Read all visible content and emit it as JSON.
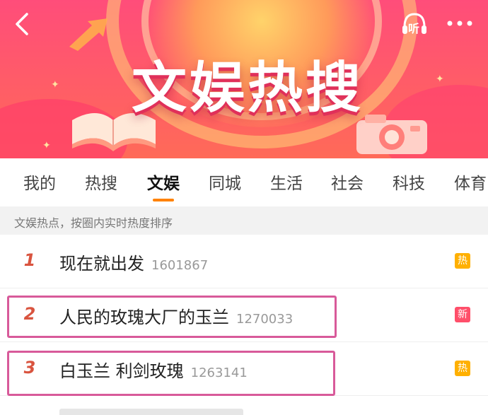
{
  "banner": {
    "title": "文娱热搜",
    "listen_label": "听",
    "colors": {
      "bg_top": "#ff4d7a",
      "bg_bottom": "#ff6a58",
      "accent": "#ffd36a"
    }
  },
  "tabs": [
    {
      "label": "我的",
      "active": false
    },
    {
      "label": "热搜",
      "active": false
    },
    {
      "label": "文娱",
      "active": true
    },
    {
      "label": "同城",
      "active": false
    },
    {
      "label": "生活",
      "active": false
    },
    {
      "label": "社会",
      "active": false
    },
    {
      "label": "科技",
      "active": false
    },
    {
      "label": "体育",
      "active": false
    }
  ],
  "subtitle": "文娱热点，按圈内实时热度排序",
  "list": [
    {
      "rank": "1",
      "title": "现在就出发",
      "count": "1601867",
      "badge": "热",
      "badge_type": "hot"
    },
    {
      "rank": "2",
      "title": "人民的玫瑰大厂的玉兰",
      "count": "1270033",
      "badge": "新",
      "badge_type": "new"
    },
    {
      "rank": "3",
      "title": "白玉兰 利剑玫瑰",
      "count": "1263141",
      "badge": "热",
      "badge_type": "hot"
    }
  ],
  "colors": {
    "tab_indicator": "#ff8200",
    "rank": "#d9543f",
    "badge_hot": "#ffb000",
    "badge_new": "#ff4f6a",
    "highlight_box": "#d85a9a"
  }
}
